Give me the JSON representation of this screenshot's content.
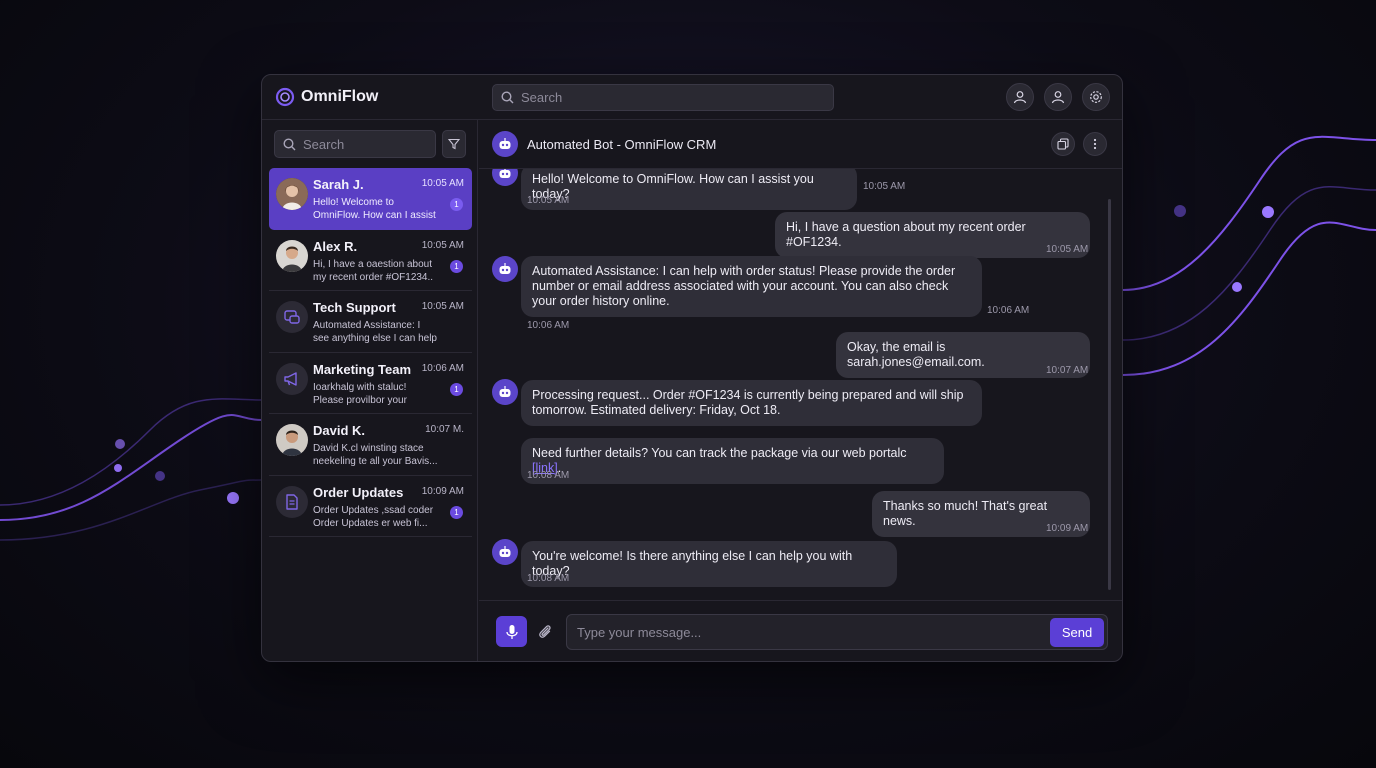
{
  "app": {
    "brand": "OmniFlow",
    "search_placeholder": "Search",
    "icons": [
      "user-icon",
      "user-icon",
      "settings-icon"
    ]
  },
  "sidebar": {
    "search_placeholder": "Search",
    "conversations": [
      {
        "name": "Sarah J.",
        "time": "10:05 AM",
        "preview": "Hello! Welcome to OmniFlow. How can I assist you today...",
        "badge": "1",
        "active": true,
        "avatar": "photo"
      },
      {
        "name": "Alex R.",
        "time": "10:05 AM",
        "preview": "Hi, I have a oaestion about my recent order #OF1234..",
        "badge": "1",
        "active": false,
        "avatar": "photo"
      },
      {
        "name": "Tech Support",
        "time": "10:05 AM",
        "preview": "Automated Assistance: I see anything else I can help yo..",
        "badge": "",
        "active": false,
        "avatar": "support-icon"
      },
      {
        "name": "Marketing Team",
        "time": "10:06 AM",
        "preview": "Ioarkhalg with staluc! Please provilbor your ordie...",
        "badge": "1",
        "active": false,
        "avatar": "megaphone-icon"
      },
      {
        "name": "David K.",
        "time": "10:07 M.",
        "preview": "David K.cl winsting stace neekeling te all your Bavis...",
        "badge": "",
        "active": false,
        "avatar": "photo"
      },
      {
        "name": "Order Updates",
        "time": "10:09 AM",
        "preview": "Order Updates ,ssad coder Order Updates er web fi...",
        "badge": "1",
        "active": false,
        "avatar": "document-icon"
      }
    ]
  },
  "chat": {
    "title": "Automated Bot - OmniFlow CRM",
    "messages": [
      {
        "from": "bot",
        "text": "Hello! Welcome to OmniFlow. How can I assist you today?",
        "time_inline": "10:05 AM",
        "time": "10:05 AM"
      },
      {
        "from": "user",
        "text": "Hi, I have a question about my recent order #OF1234.",
        "time": "10:05 AM"
      },
      {
        "from": "bot",
        "text": "Automated Assistance: I can help with order status! Please provide the order number or email address associated with your account. You can also check your order history online.",
        "time_inline": "10:06 AM",
        "time": "10:06 AM"
      },
      {
        "from": "user",
        "text": "Okay, the email is sarah.jones@email.com.",
        "time": "10:07 AM"
      },
      {
        "from": "bot",
        "text": "Processing request... Order #OF1234 is currently being prepared and will ship tomorrow. Estimated delivery: Friday, Oct 18."
      },
      {
        "from": "bot",
        "text": "Need further details? You can track the package via our web portalc ",
        "link": "[link]",
        "suffix": ".",
        "time": "10:08 AM"
      },
      {
        "from": "user",
        "text": "Thanks so much! That's great news.",
        "time": "10:09 AM"
      },
      {
        "from": "bot",
        "text": "You're welcome! Is there anything else I can help you with today?",
        "time": "10:08 AM"
      }
    ],
    "composer_placeholder": "Type your message...",
    "send_label": "Send"
  },
  "colors": {
    "accent": "#5b3fd6",
    "active_row": "#5a3fc4",
    "panel": "#17161d"
  }
}
